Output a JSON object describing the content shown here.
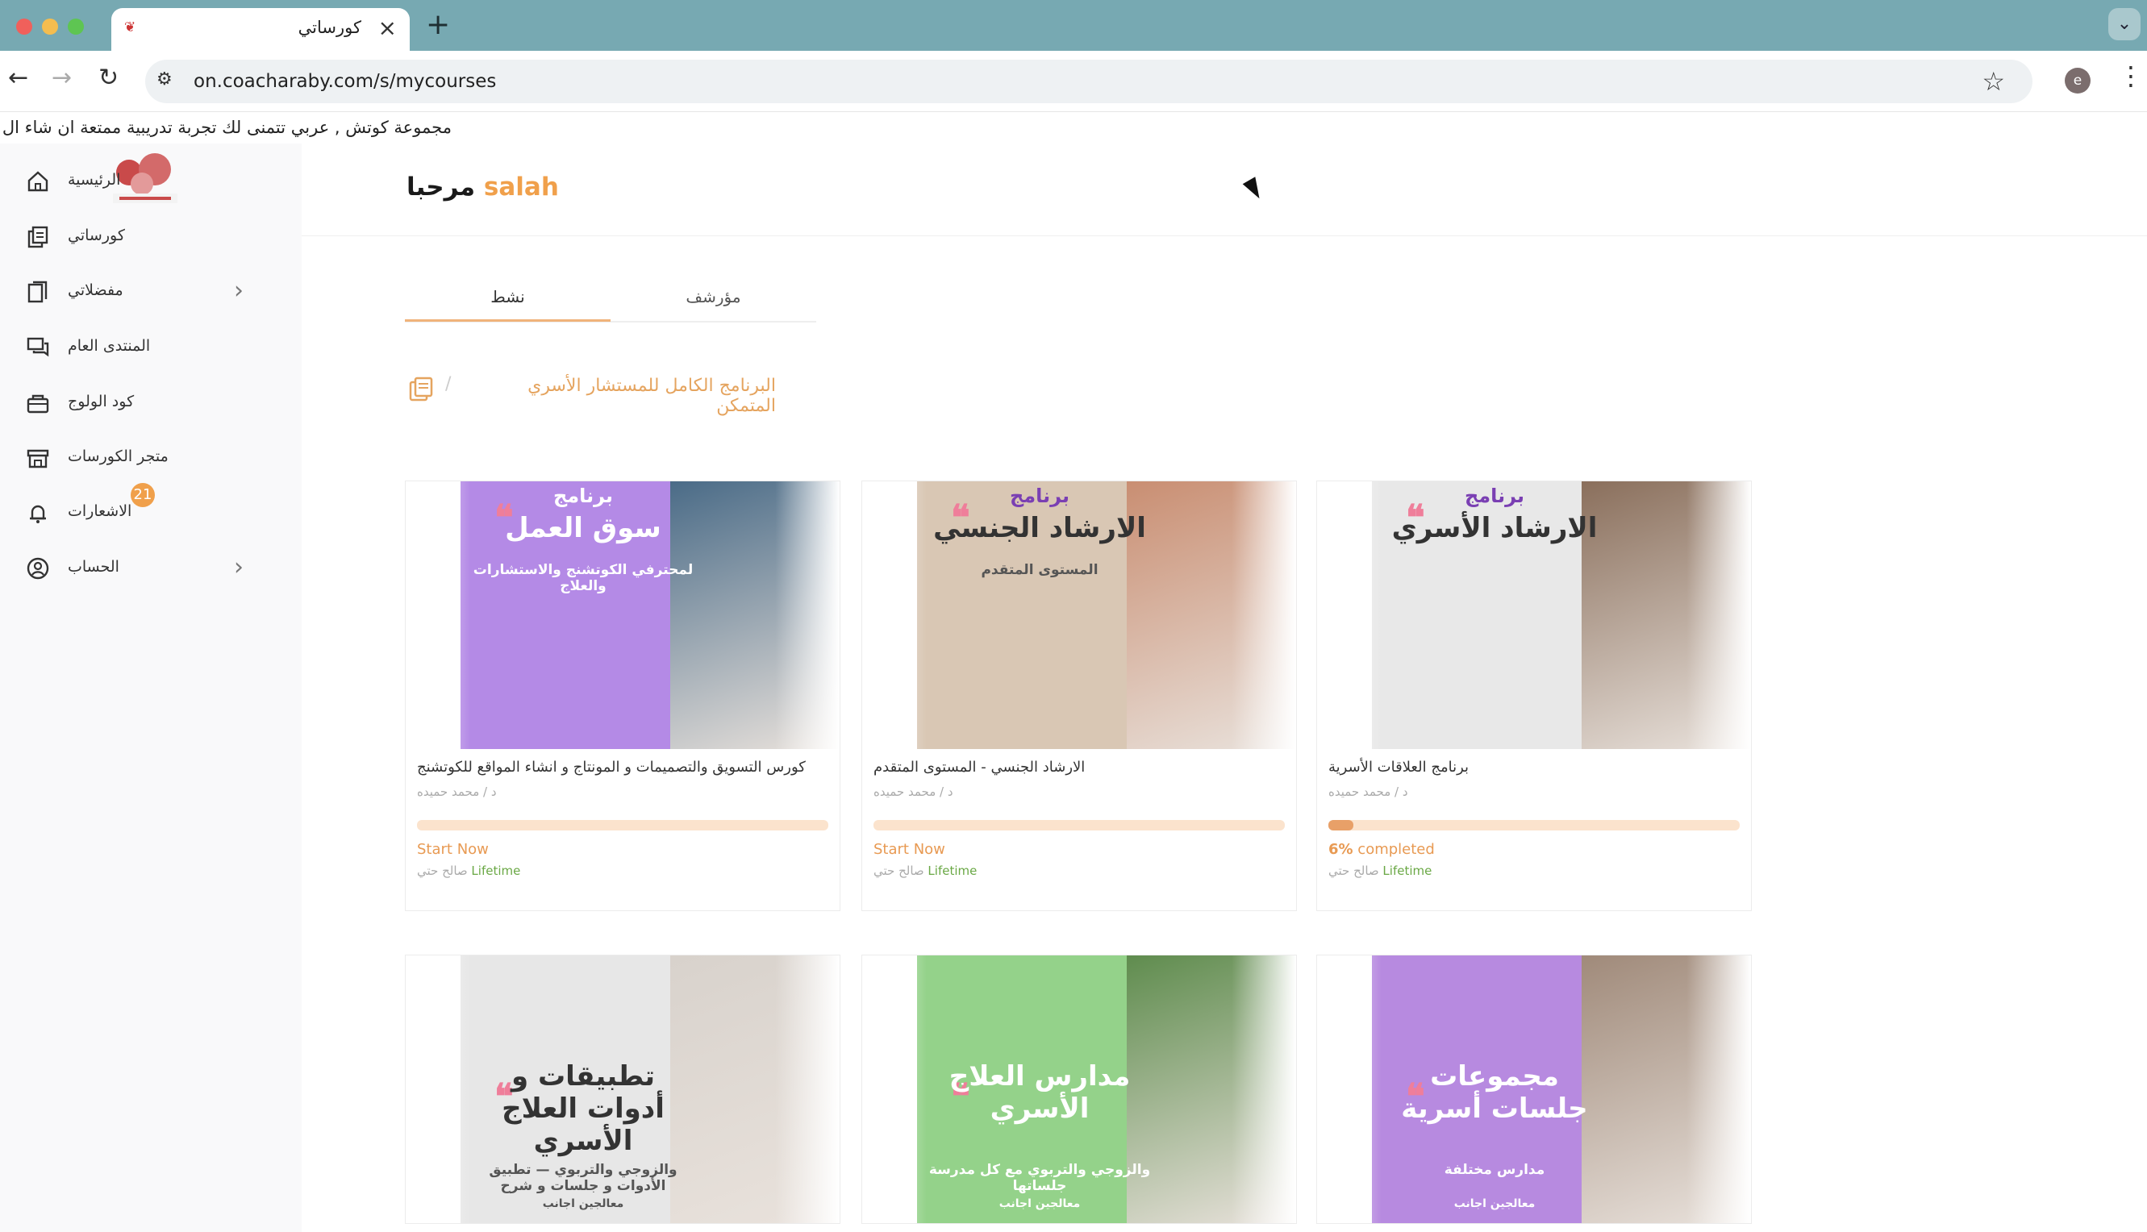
{
  "browser": {
    "tab_title": "كورساتي",
    "tab_close": "×",
    "new_tab": "+",
    "tab_menu": "⌄",
    "url": "on.coacharaby.com/s/mycourses",
    "profile_initial": "e"
  },
  "marquee": "مجموعة كوتش , عربي تتمنى لك تجربة تدريبية ممتعة ان شاء ال",
  "header": {
    "welcome": "مرحبا",
    "user": "salah"
  },
  "sidebar": {
    "items": [
      {
        "label": "الرئيسية",
        "icon": "home-icon"
      },
      {
        "label": "كورساتي",
        "icon": "courses-icon"
      },
      {
        "label": "مفضلاتي",
        "icon": "bookmark-icon",
        "chevron": true
      },
      {
        "label": "المنتدى العام",
        "icon": "forum-icon"
      },
      {
        "label": "كود الولوج",
        "icon": "code-icon"
      },
      {
        "label": "متجر الكورسات",
        "icon": "store-icon"
      },
      {
        "label": "الاشعارات",
        "icon": "bell-icon",
        "badge": "21"
      },
      {
        "label": "الحساب",
        "icon": "account-icon",
        "chevron": true
      }
    ]
  },
  "tabs": {
    "active": "نشط",
    "archived": "مؤرشف"
  },
  "breadcrumb": {
    "separator": "/",
    "title": "البرنامج الكامل للمستشار الأسري المتمكن"
  },
  "cards": [
    {
      "thumb": {
        "small": "برنامج",
        "big": "سوق العمل",
        "sub": "لمحترفي الكوتشنج والاستشارات والعلاج",
        "panel_color": "#b48ae6",
        "photo_color": "#4a6b87"
      },
      "title": "كورس التسويق والتصميمات و المونتاج و انشاء المواقع للكوتشنج",
      "author": "د / محمد حميده",
      "progress": 0,
      "status": "Start Now",
      "footer_name": "صالح حتي",
      "footer_access": "Lifetime"
    },
    {
      "thumb": {
        "small": "برنامج",
        "big": "الارشاد الجنسي",
        "sub": "المستوى المتقدم",
        "panel_color": "#d9c7b4",
        "photo_color": "#c98e72"
      },
      "title": "الارشاد الجنسي - المستوى المتقدم",
      "author": "د / محمد حميده",
      "progress": 0,
      "status": "Start Now",
      "footer_name": "صالح حتي",
      "footer_access": "Lifetime"
    },
    {
      "thumb": {
        "small": "برنامج",
        "big": "الارشاد الأسري",
        "sub": "",
        "panel_color": "#e8e8e8",
        "photo_color": "#8a6f5c"
      },
      "title": "برنامج العلاقات الأسرية",
      "author": "د / محمد حميده",
      "progress": 6,
      "status_pct": "6%",
      "status": "completed",
      "footer_name": "صالح حتي",
      "footer_access": "Lifetime"
    },
    {
      "thumb": {
        "small": "",
        "big": "تطبيقات و أدوات العلاج الأسري",
        "sub": "والزوجي والتربوي — تطبيق الأدوات و جلسات و شرح",
        "caption": "معالجين اجانب",
        "panel_color": "#e7e7e7",
        "photo_color": "#d8d2cc"
      },
      "title": "",
      "author": "",
      "progress": 0,
      "status": "",
      "footer_name": "",
      "footer_access": ""
    },
    {
      "thumb": {
        "small": "",
        "big": "مدارس العلاج الأسري",
        "sub": "والزوجي والتربوي مع كل مدرسة جلساتها",
        "caption": "معالجين اجانب",
        "panel_color": "#94d28a",
        "photo_color": "#5f8c4e"
      },
      "title": "",
      "author": "",
      "progress": 0,
      "status": "",
      "footer_name": "",
      "footer_access": ""
    },
    {
      "thumb": {
        "small": "",
        "big": "مجموعات جلسات أسرية",
        "sub": "مدارس مختلفة",
        "caption": "معالجين اجانب",
        "panel_color": "#b78ae0",
        "photo_color": "#a08a7a"
      },
      "title": "",
      "author": "",
      "progress": 0,
      "status": "",
      "footer_name": "",
      "footer_access": ""
    }
  ],
  "colors": {
    "accent": "#f0a04b",
    "lifetime": "#6aa845",
    "progress_track": "#fbe3cd",
    "progress_fill": "#e8a068"
  }
}
